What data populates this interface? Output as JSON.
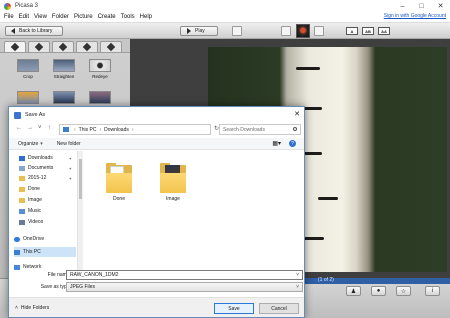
{
  "app": {
    "title": "Picasa 3",
    "menu": [
      "File",
      "Edit",
      "View",
      "Folder",
      "Picture",
      "Create",
      "Tools",
      "Help"
    ],
    "signin": "Sign in with Google Account",
    "window_controls": [
      "minimize-icon",
      "maximize-icon",
      "close-icon"
    ],
    "back_label": "Back to Library",
    "play_label": "Play",
    "caption_buttons": [
      "A",
      "AB",
      "AA"
    ],
    "tools": [
      {
        "label": "Crop"
      },
      {
        "label": "Straighten"
      },
      {
        "label": "Redeye"
      },
      {
        "label": ""
      },
      {
        "label": ""
      },
      {
        "label": ""
      }
    ],
    "page_count": "(1 of 2)"
  },
  "dialog": {
    "title": "Save As",
    "close": "✕",
    "path": [
      "This PC",
      "Downloads"
    ],
    "search_placeholder": "Search Downloads",
    "organize": "Organize",
    "new_folder": "New folder",
    "nav": [
      {
        "label": "Downloads",
        "pinned": true
      },
      {
        "label": "Documents",
        "pinned": true
      },
      {
        "label": "2015-12",
        "pinned": true
      },
      {
        "label": "Done",
        "pinned": false
      },
      {
        "label": "Image",
        "pinned": false
      },
      {
        "label": "Music",
        "pinned": false
      },
      {
        "label": "Videos",
        "pinned": false
      },
      {
        "label": "OneDrive",
        "pinned": false
      },
      {
        "label": "This PC",
        "pinned": false,
        "selected": true
      },
      {
        "label": "Network",
        "pinned": false
      }
    ],
    "files": [
      {
        "name": "Done",
        "type": "folder"
      },
      {
        "name": "Image",
        "type": "folder"
      }
    ],
    "file_name_label": "File name:",
    "file_name_value": "RAW_CANON_1DM2",
    "save_type_label": "Save as type:",
    "save_type_value": "JPEG Files",
    "hide_folders": "Hide Folders",
    "save_label": "Save",
    "cancel_label": "Cancel"
  }
}
